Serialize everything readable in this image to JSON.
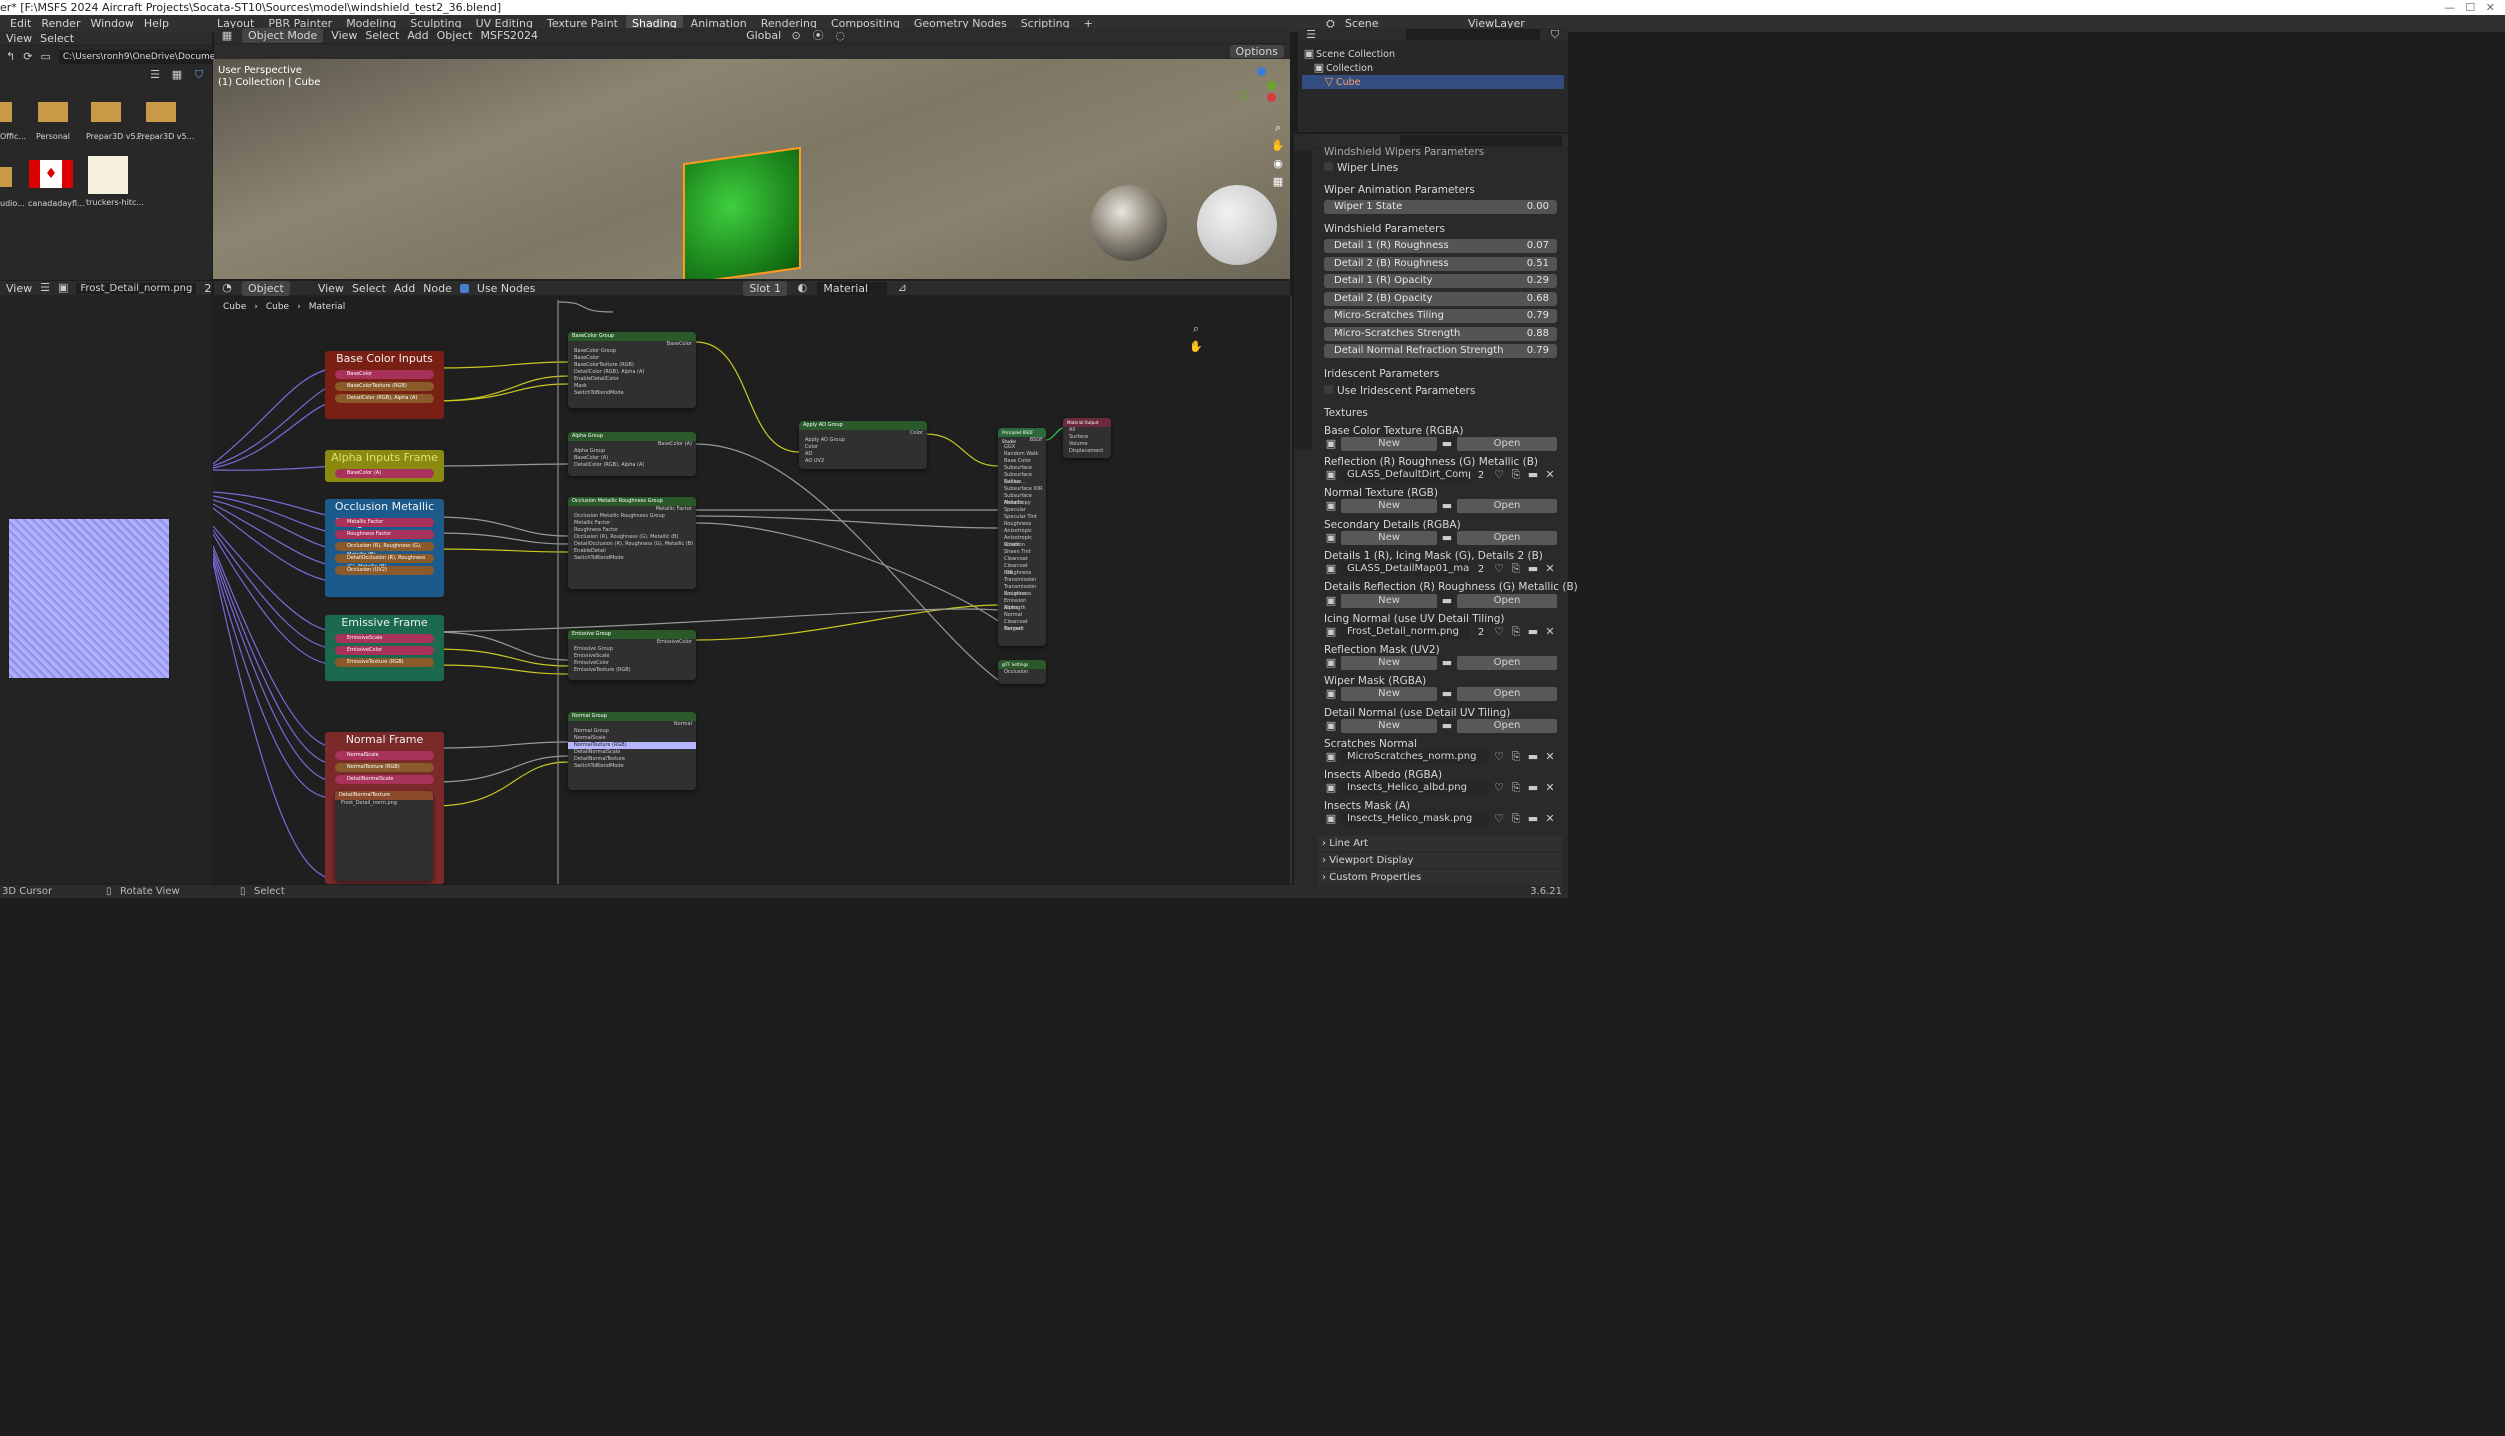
{
  "title_bar": {
    "text": "er* [F:\\MSFS 2024 Aircraft Projects\\Socata-ST10\\Sources\\model\\windshield_test2_36.blend]"
  },
  "menu": [
    "Edit",
    "Render",
    "Window",
    "Help"
  ],
  "workspaces": [
    "Layout",
    "PBR Painter",
    "Modeling",
    "Sculpting",
    "UV Editing",
    "Texture Paint",
    "Shading",
    "Animation",
    "Rendering",
    "Compositing",
    "Geometry Nodes",
    "Scripting",
    "+"
  ],
  "active_workspace": "Shading",
  "scene": {
    "label": "Scene",
    "viewlayer": "ViewLayer"
  },
  "file_browser": {
    "menu": [
      "View",
      "Select"
    ],
    "path": "C:\\Users\\ronh9\\OneDrive\\Documents\\",
    "items": [
      {
        "name": "Offic...",
        "type": "folder"
      },
      {
        "name": "Personal",
        "type": "folder"
      },
      {
        "name": "Prepar3D v5...",
        "type": "folder"
      },
      {
        "name": "Prepar3D v5...",
        "type": "folder"
      },
      {
        "name": "udio...",
        "type": "folder"
      },
      {
        "name": "canadadayfl...",
        "type": "image"
      },
      {
        "name": "truckers-hitc...",
        "type": "image"
      }
    ]
  },
  "viewport": {
    "mode": "Object Mode",
    "menu": [
      "View",
      "Select",
      "Add",
      "Object",
      "MSFS2024"
    ],
    "transform": "Global",
    "options": "Options",
    "info1": "User Perspective",
    "info2": "(1) Collection | Cube"
  },
  "image_editor": {
    "menu": [
      "View"
    ],
    "image": "Frost_Detail_norm.png",
    "users": "2"
  },
  "node_editor": {
    "type": "Object",
    "menu": [
      "View",
      "Select",
      "Add",
      "Node"
    ],
    "use_nodes": "Use Nodes",
    "slot": "Slot 1",
    "material": "Material",
    "breadcrumb": [
      "Cube",
      "Cube",
      "Material"
    ]
  },
  "frames": [
    {
      "title": "Base Color Inputs Frame",
      "color": "#7a1f14",
      "sockets": [
        "BaseColor",
        "BaseColorTexture (RGB)",
        "DetailColor (RGB), Alpha (A)"
      ]
    },
    {
      "title": "Alpha Inputs Frame",
      "color": "#8a8a10",
      "sockets": [
        "BaseColor (A)"
      ]
    },
    {
      "title": "Occlusion Metallic Roughness Frame",
      "color": "#1b5a8a",
      "sockets": [
        "Metallic Factor",
        "Roughness Factor",
        "Occlusion (R), Roughness (G), Metallic (B)",
        "DetailOcclusion (R), Roughness (G), Metallic (B)",
        "Occlusion (UV2)"
      ]
    },
    {
      "title": "Emissive Frame",
      "color": "#1b6a4e",
      "sockets": [
        "EmissiveScale",
        "EmissiveColor",
        "EmissiveTexture (RGB)"
      ]
    },
    {
      "title": "Normal Frame",
      "color": "#7a2a2a",
      "sockets": [
        "NormalScale",
        "NormalTexture (RGB)",
        "DetailNormalScale",
        "DetailNormalTexture"
      ]
    }
  ],
  "groups": [
    {
      "title": "BaseColor Group",
      "out": "BaseColor",
      "rows": [
        "BaseColor Group",
        "BaseColor",
        "BaseColorTexture (RGB)",
        "DetailColor (RGB), Alpha (A)",
        "DetailColor (RGB), Alpha (A)",
        "EnableDetailColor",
        "Mask",
        "SwitchToBlendMode"
      ]
    },
    {
      "title": "Alpha Group",
      "out": "BaseColor (A)",
      "rows": [
        "Alpha Group",
        "BaseColor (A)",
        "BaseColorTexture (RGB)",
        "DetailColor (RGB), Alpha (A)"
      ]
    },
    {
      "title": "Occlusion Metallic Roughness Group",
      "out": "Metallic Factor",
      "rows": [
        "Occlusion Metallic Roughness Group",
        "Metallic Factor",
        "Roughness Factor",
        "Occlusion (R), Roughness (G), Metallic (B)",
        "DetailOcclusion (R), Roughness (G), Metallic (B)",
        "EnableDetail",
        "Mask",
        "SwitchToBlendMode"
      ]
    },
    {
      "title": "Emissive Group",
      "out": "EmissiveColor",
      "rows": [
        "Emissive Group",
        "EmissiveScale",
        "EmissiveColor",
        "EmissiveTexture (RGB)"
      ]
    },
    {
      "title": "Normal Group",
      "out": "Normal",
      "rows": [
        "Normal Group",
        "NormalScale",
        "NormalTexture (RGB)",
        "DetailNormalScale",
        "DetailNormalTexture",
        "EnableDetail",
        "Mask",
        "SwitchToBlendMode"
      ]
    },
    {
      "title": "Apply AO Group",
      "out": "Color",
      "rows": [
        "Apply AO Group",
        "Color",
        "AO",
        "AO UV2"
      ]
    },
    {
      "title": "Principled BSDF Shader",
      "out": "BSDF",
      "rows": [
        "GGX",
        "Random Walk",
        "Base Color",
        "Subsurface",
        "Subsurface Radius",
        "Subsur...",
        "Subsurface IOR",
        "Subsurface Anisotropy",
        "Metallic",
        "Specular",
        "Specular Tint",
        "Roughness",
        "Anisotropic",
        "Anisotropic Rotation",
        "Sheen",
        "Sheen Tint",
        "Clearcoat",
        "Clearcoat Roughness",
        "IOR",
        "Transmission",
        "Transmission Roughness",
        "Emission",
        "Emission Strength",
        "Alpha",
        "Normal",
        "Clearcoat Normal",
        "Tangent"
      ]
    },
    {
      "title": "Material Output",
      "out": "All",
      "rows": [
        "Surface",
        "Volume",
        "Displacement"
      ]
    },
    {
      "title": "glTF Settings",
      "out": "",
      "rows": [
        "glTF Settings",
        "Occlusion"
      ]
    }
  ],
  "outliner": {
    "root": "Scene Collection",
    "collection": "Collection",
    "object": "Cube"
  },
  "properties": {
    "top_section": "Windshield Wipers Parameters",
    "wiper_lines": "Wiper Lines",
    "wiper_anim": "Wiper Animation Parameters",
    "wiper_state": {
      "label": "Wiper 1 State",
      "value": "0.00"
    },
    "windshield": "Windshield Parameters",
    "params": [
      {
        "label": "Detail 1 (R) Roughness",
        "value": "0.07"
      },
      {
        "label": "Detail 2 (B) Roughness",
        "value": "0.51"
      },
      {
        "label": "Detail 1 (R) Opacity",
        "value": "0.29"
      },
      {
        "label": "Detail 2 (B) Opacity",
        "value": "0.68"
      },
      {
        "label": "Micro-Scratches Tiling",
        "value": "0.79"
      },
      {
        "label": "Micro-Scratches Strength",
        "value": "0.88"
      },
      {
        "label": "Detail Normal Refraction Strength",
        "value": "0.79"
      }
    ],
    "iridescent": "Iridescent Parameters",
    "use_iridescent": "Use Iridescent Parameters",
    "textures_title": "Textures",
    "new_label": "New",
    "open_label": "Open",
    "textures": [
      {
        "label": "Base Color Texture (RGBA)",
        "file": "",
        "users": ""
      },
      {
        "label": "Reflection (R) Roughness (G) Metallic (B)",
        "file": "GLASS_DefaultDirt_Comp.png",
        "users": "2"
      },
      {
        "label": "Normal Texture (RGB)",
        "file": "",
        "users": ""
      },
      {
        "label": "Secondary Details (RGBA)",
        "file": "",
        "users": ""
      },
      {
        "label": "Details 1 (R), Icing Mask (G), Details 2 (B)",
        "file": "GLASS_DetailMap01_mask.png",
        "users": "2"
      },
      {
        "label": "Details Reflection (R) Roughness (G) Metallic (B)",
        "file": "",
        "users": ""
      },
      {
        "label": "Icing Normal (use UV Detail Tiling)",
        "file": "Frost_Detail_norm.png",
        "users": "2"
      },
      {
        "label": "Reflection Mask (UV2)",
        "file": "",
        "users": ""
      },
      {
        "label": "Wiper Mask (RGBA)",
        "file": "",
        "users": ""
      },
      {
        "label": "Detail Normal (use Detail UV Tiling)",
        "file": "",
        "users": ""
      },
      {
        "label": "Scratches Normal",
        "file": "MicroScratches_norm.png",
        "users": ""
      },
      {
        "label": "Insects Albedo (RGBA)",
        "file": "Insects_Helico_albd.png",
        "users": ""
      },
      {
        "label": "Insects Mask (A)",
        "file": "Insects_Helico_mask.png",
        "users": ""
      }
    ],
    "collapsed": [
      "Line Art",
      "Viewport Display",
      "Custom Properties"
    ]
  },
  "status": {
    "left": "3D Cursor",
    "mid": "Rotate View",
    "select": "Select",
    "version": "3.6.21"
  }
}
